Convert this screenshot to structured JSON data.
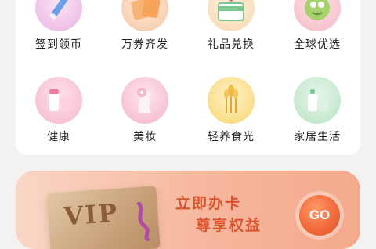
{
  "categories": [
    {
      "label": "签到领币",
      "icon": "pen-checkin-icon"
    },
    {
      "label": "万券齐发",
      "icon": "coupons-icon"
    },
    {
      "label": "礼品兑换",
      "icon": "gift-box-icon"
    },
    {
      "label": "全球优选",
      "icon": "globe-fruit-icon"
    },
    {
      "label": "健康",
      "icon": "health-bottles-icon"
    },
    {
      "label": "美妆",
      "icon": "beauty-face-icon"
    },
    {
      "label": "轻养食光",
      "icon": "wheat-icon"
    },
    {
      "label": "家居生活",
      "icon": "home-bottles-icon"
    }
  ],
  "promo": {
    "card_text": "VIP",
    "title": "立即办卡",
    "subtitle": "尊享权益",
    "button": "GO",
    "accent": "#d9532c"
  }
}
